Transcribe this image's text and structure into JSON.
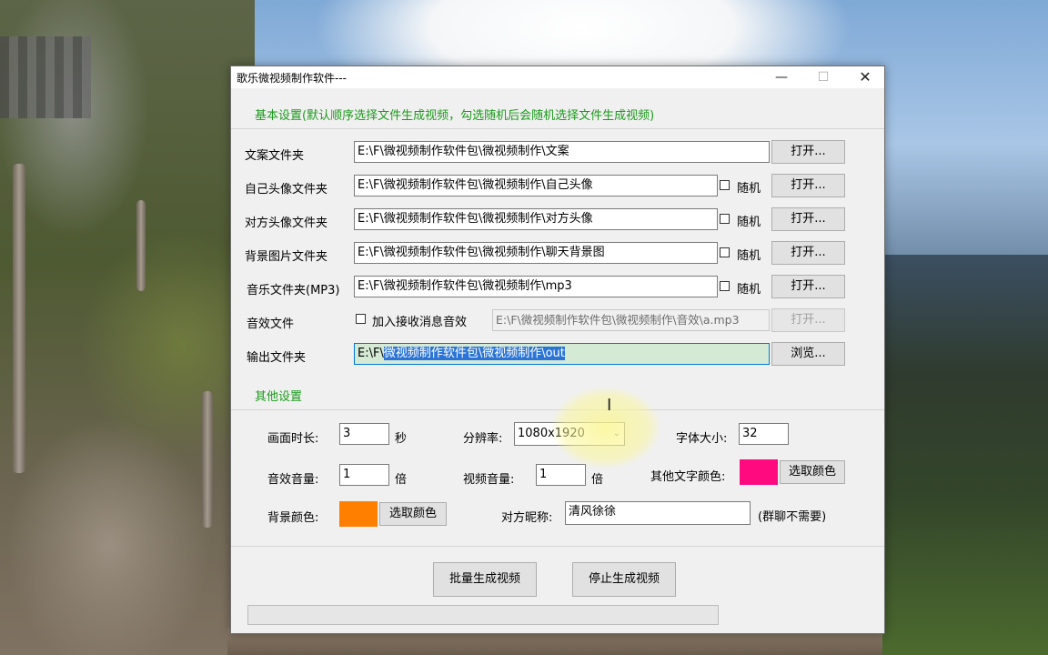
{
  "window": {
    "title": "歌乐微视频制作软件---",
    "controls": {
      "minimize": "—",
      "maximize": "☐",
      "close": "✕"
    }
  },
  "basic": {
    "section_label": "基本设置(默认顺序选择文件生成视频，勾选随机后会随机选择文件生成视频)",
    "rows": [
      {
        "label": "文案文件夹",
        "path": "E:\\F\\微视频制作软件包\\微视频制作\\文案",
        "button": "打开..."
      },
      {
        "label": "自己头像文件夹",
        "path": "E:\\F\\微视频制作软件包\\微视频制作\\自己头像",
        "random": "随机",
        "button": "打开..."
      },
      {
        "label": "对方头像文件夹",
        "path": "E:\\F\\微视频制作软件包\\微视频制作\\对方头像",
        "random": "随机",
        "button": "打开..."
      },
      {
        "label": "背景图片文件夹",
        "path": "E:\\F\\微视频制作软件包\\微视频制作\\聊天背景图",
        "random": "随机",
        "button": "打开..."
      },
      {
        "label": "音乐文件夹(MP3)",
        "path": "E:\\F\\微视频制作软件包\\微视频制作\\mp3",
        "random": "随机",
        "button": "打开..."
      }
    ],
    "sound": {
      "label": "音效文件",
      "checkbox": "加入接收消息音效",
      "path": "E:\\F\\微视频制作软件包\\微视频制作\\音效\\a.mp3",
      "button": "打开..."
    },
    "output": {
      "label": "输出文件夹",
      "path_prefix": "E:\\F\\",
      "path_selected": "微视频制作软件包\\微视频制作\\out",
      "button": "浏览..."
    }
  },
  "other": {
    "section_label": "其他设置",
    "duration": {
      "label": "画面时长:",
      "value": "3",
      "unit": "秒"
    },
    "resolution": {
      "label": "分辨率:",
      "value": "1080x1920"
    },
    "font_size": {
      "label": "字体大小:",
      "value": "32"
    },
    "sfx_volume": {
      "label": "音效音量:",
      "value": "1",
      "unit": "倍"
    },
    "video_volume": {
      "label": "视频音量:",
      "value": "1",
      "unit": "倍"
    },
    "other_text_color": {
      "label": "其他文字颜色:",
      "color": "#ff0a7f",
      "button": "选取颜色"
    },
    "bg_color": {
      "label": "背景颜色:",
      "color": "#ff7f00",
      "button": "选取颜色"
    },
    "nickname": {
      "label": "对方昵称:",
      "value": "清风徐徐",
      "note": "(群聊不需要)"
    }
  },
  "actions": {
    "batch": "批量生成视频",
    "stop": "停止生成视频"
  },
  "progress": {
    "value": 0
  }
}
